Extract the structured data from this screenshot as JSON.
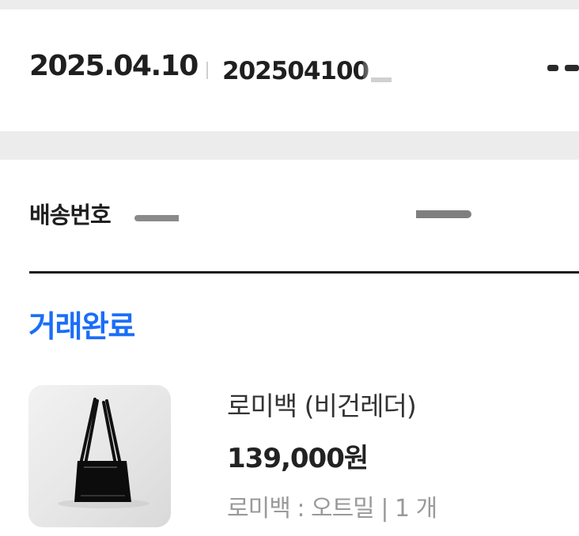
{
  "order": {
    "date": "2025.04.10",
    "number_visible": "202504100"
  },
  "shipping": {
    "label": "배송번호"
  },
  "status": {
    "label": "거래완료",
    "color": "#1a6ef7"
  },
  "product": {
    "image_icon": "shoulder-bag-icon",
    "name": "로미백 (비건레더)",
    "price": "139,000원",
    "option": "로미백 : 오트밀 | 1 개"
  }
}
